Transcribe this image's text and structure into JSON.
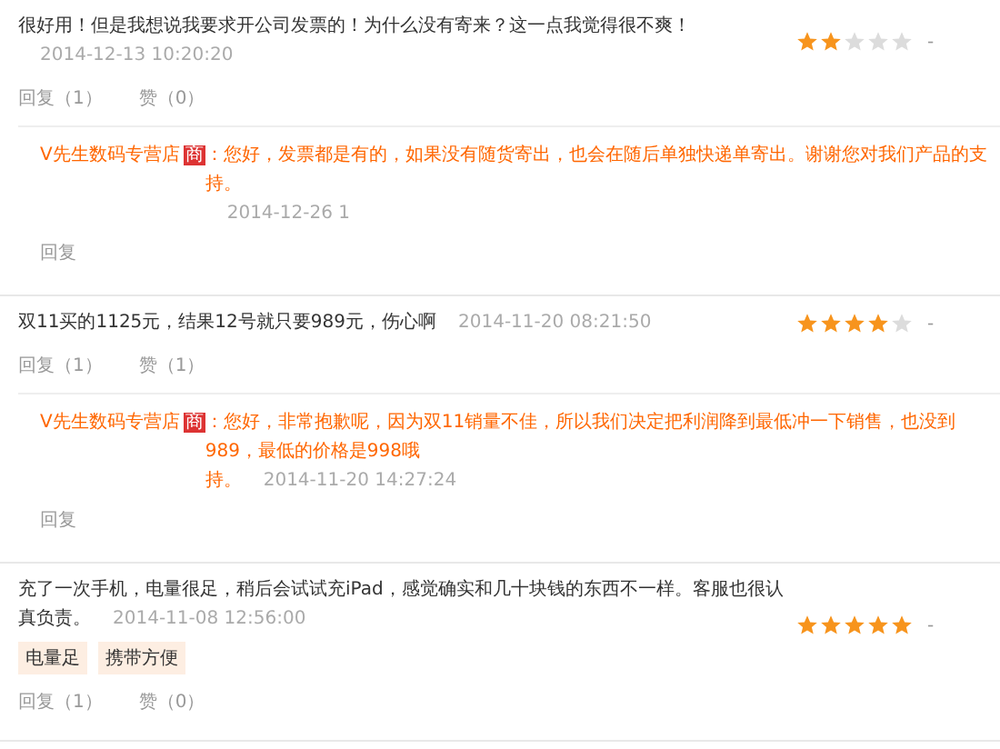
{
  "reviews": [
    {
      "text": "很好用！但是我想说我要求开公司发票的！为什么没有寄来？这一点我觉得很不爽！",
      "time": "2014-12-13 10:20:20",
      "stars": 2,
      "score": "-",
      "reply_count": "回复（1）",
      "like_count": "赞（0）",
      "seller_reply": {
        "shop": "V先生数码专营店",
        "badge": "商",
        "text_lines": [
          "：您好，发票都是有的，如果没有随货寄出，也会在随后单独快递单寄出。谢谢您对我们产品的支持。"
        ],
        "time": "2014-12-26 1",
        "reply_link": "回复"
      }
    },
    {
      "text": "双11买的1125元，结果12号就只要989元，伤心啊",
      "time": "2014-11-20 08:21:50",
      "stars": 4,
      "score": "-",
      "reply_count": "回复（1）",
      "like_count": "赞（1）",
      "seller_reply": {
        "shop": "V先生数码专营店",
        "badge": "商",
        "text_lines": [
          "：您好，非常抱歉呢，因为双11销量不佳，所以我们决定把利润降到最低冲一下销售，也没到989，最低的价格是998哦",
          "持。"
        ],
        "time": "2014-11-20 14:27:24",
        "reply_link": "回复"
      }
    },
    {
      "text": "充了一次手机，电量很足，稍后会试试充iPad，感觉确实和几十块钱的东西不一样。客服也很认真负责。",
      "time": "2014-11-08 12:56:00",
      "stars": 5,
      "score": "-",
      "tags": [
        "电量足",
        "携带方便"
      ],
      "reply_count": "回复（1）",
      "like_count": "赞（0）"
    }
  ]
}
